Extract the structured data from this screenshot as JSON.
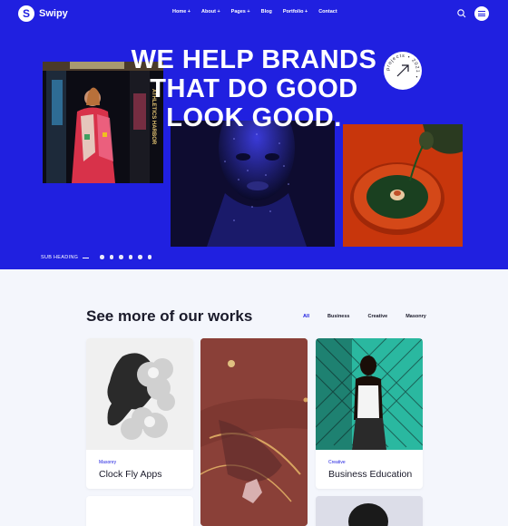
{
  "brand": {
    "name": "Swipy",
    "logo_letter": "S"
  },
  "nav": {
    "items": [
      {
        "label": "Home +"
      },
      {
        "label": "About +"
      },
      {
        "label": "Pages +"
      },
      {
        "label": "Blog"
      },
      {
        "label": "Portfolio +"
      },
      {
        "label": "Contact"
      }
    ]
  },
  "hero": {
    "headline_lines": [
      "WE HELP BRANDS",
      "THAT DO GOOD",
      "LOOK GOOD."
    ],
    "subheading": "SUB HEADING",
    "badge_text": "projects • 2021 • ",
    "image1_side_text": "ATHLETICS HARBOR",
    "social_icons": [
      "facebook-icon",
      "twitter-icon",
      "linkedin-icon",
      "instagram-icon",
      "behance-icon",
      "dribbble-icon"
    ]
  },
  "works": {
    "title": "See more of our works",
    "filters": [
      {
        "label": "All",
        "active": true
      },
      {
        "label": "Business",
        "active": false
      },
      {
        "label": "Creative",
        "active": false
      },
      {
        "label": "Masonry",
        "active": false
      }
    ],
    "cards": [
      {
        "category": "Masonry",
        "title": "Clock Fly Apps"
      },
      {
        "category": "Creative",
        "title": "Business Education"
      }
    ]
  },
  "colors": {
    "primary": "#2020e0",
    "background": "#f4f6fc",
    "text": "#1a1a2a"
  }
}
